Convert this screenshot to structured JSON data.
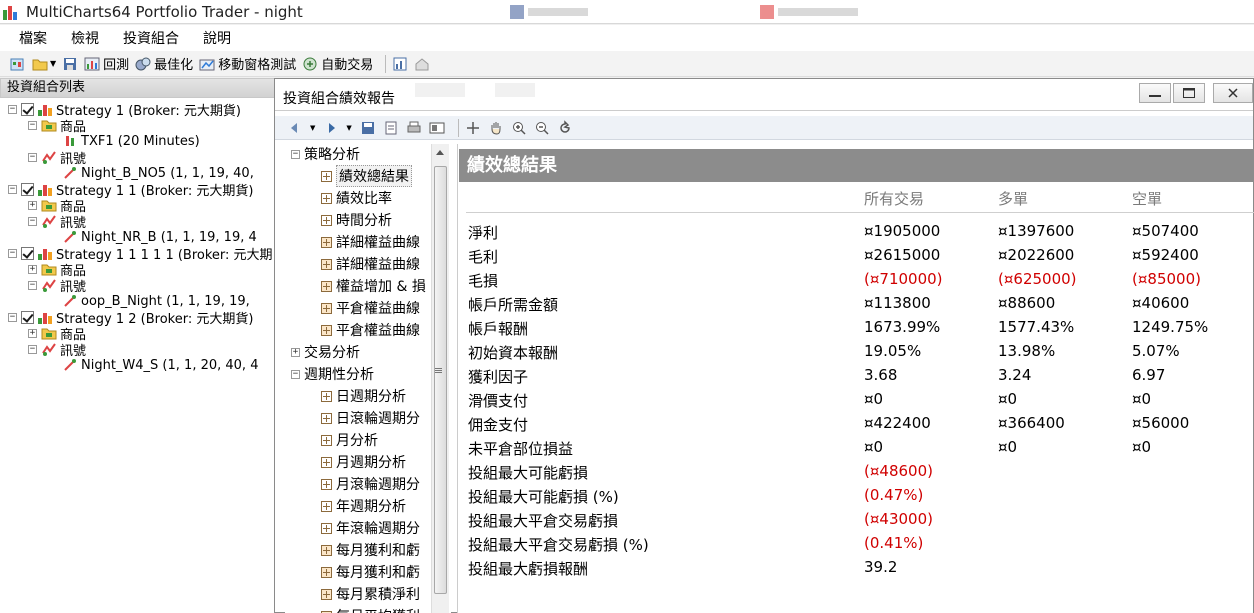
{
  "window": {
    "title": "MultiCharts64 Portfolio Trader - night"
  },
  "menu": [
    "檔案",
    "檢視",
    "投資組合",
    "說明"
  ],
  "toolbar": {
    "backtest": "回測",
    "optimize": "最佳化",
    "wfa": "移動窗格測試",
    "autotrade": "自動交易"
  },
  "left_panel": {
    "title": "投資組合列表",
    "rows": [
      {
        "level": 0,
        "expander": "-",
        "check": true,
        "text": "Strategy 1 (Broker: 元大期貨)"
      },
      {
        "level": 1,
        "expander": "-",
        "text": "商品",
        "icon": "folder-icon"
      },
      {
        "level": 2,
        "text": "TXF1 (20 Minutes)",
        "icon": "instrument-icon"
      },
      {
        "level": 1,
        "expander": "-",
        "text": "訊號",
        "icon": "signal-icon"
      },
      {
        "level": 2,
        "text": "Night_B_NO5 (1,  1,  19,  40,",
        "icon": "signal-item-icon"
      },
      {
        "level": 0,
        "expander": "-",
        "check": true,
        "text": "Strategy 1 1 (Broker: 元大期貨)"
      },
      {
        "level": 1,
        "expander": "+",
        "text": "商品",
        "icon": "folder-icon"
      },
      {
        "level": 1,
        "expander": "-",
        "text": "訊號",
        "icon": "signal-icon"
      },
      {
        "level": 2,
        "text": "Night_NR_B (1,  1,  19,  19,  4",
        "icon": "signal-item-icon"
      },
      {
        "level": 0,
        "expander": "-",
        "check": true,
        "text": "Strategy 1 1 1 1 1 (Broker: 元大期",
        "icon": "strategy-icon"
      },
      {
        "level": 1,
        "expander": "+",
        "text": "商品",
        "icon": "folder-icon"
      },
      {
        "level": 1,
        "expander": "-",
        "text": "訊號",
        "icon": "signal-icon"
      },
      {
        "level": 2,
        "text": "oop_B_Night (1,  1,  19,  19,",
        "icon": "signal-item-icon"
      },
      {
        "level": 0,
        "expander": "-",
        "check": true,
        "text": "Strategy 1 2 (Broker: 元大期貨)"
      },
      {
        "level": 1,
        "expander": "+",
        "text": "商品",
        "icon": "folder-icon"
      },
      {
        "level": 1,
        "expander": "-",
        "text": "訊號",
        "icon": "signal-icon"
      },
      {
        "level": 2,
        "text": "Night_W4_S (1,  1,  20,  40,  4",
        "icon": "signal-item-icon"
      }
    ]
  },
  "report": {
    "title": "投資組合績效報告",
    "nav": [
      {
        "level": 0,
        "expander": "-",
        "text": "策略分析"
      },
      {
        "level": 1,
        "text": "績效總結果",
        "selected": true
      },
      {
        "level": 1,
        "text": "績效比率"
      },
      {
        "level": 1,
        "text": "時間分析"
      },
      {
        "level": 1,
        "text": "詳細權益曲線",
        "chart": true
      },
      {
        "level": 1,
        "text": "詳細權益曲線",
        "chart": true
      },
      {
        "level": 1,
        "text": "權益增加 & 損",
        "chart": true
      },
      {
        "level": 1,
        "text": "平倉權益曲線",
        "chart": true
      },
      {
        "level": 1,
        "text": "平倉權益曲線",
        "chart": true
      },
      {
        "level": 0,
        "expander": "+",
        "text": "交易分析"
      },
      {
        "level": 0,
        "expander": "-",
        "text": "週期性分析"
      },
      {
        "level": 1,
        "text": "日週期分析"
      },
      {
        "level": 1,
        "text": "日滾輪週期分"
      },
      {
        "level": 1,
        "text": "月分析"
      },
      {
        "level": 1,
        "text": "月週期分析"
      },
      {
        "level": 1,
        "text": "月滾輪週期分"
      },
      {
        "level": 1,
        "text": "年週期分析"
      },
      {
        "level": 1,
        "text": "年滾輪週期分"
      },
      {
        "level": 1,
        "text": "每月獲利和虧",
        "chart": true
      },
      {
        "level": 1,
        "text": "每月獲利和虧",
        "chart": true
      },
      {
        "level": 1,
        "text": "每月累積淨利",
        "chart": true
      },
      {
        "level": 1,
        "text": "每月平均獲利",
        "chart": true
      }
    ],
    "header": "績效總結果",
    "columns": [
      "所有交易",
      "多單",
      "空單"
    ],
    "rows": [
      {
        "label": "淨利",
        "values": [
          "¤1905000",
          "¤1397600",
          "¤507400"
        ],
        "neg": [
          false,
          false,
          false
        ]
      },
      {
        "label": "毛利",
        "values": [
          "¤2615000",
          "¤2022600",
          "¤592400"
        ],
        "neg": [
          false,
          false,
          false
        ]
      },
      {
        "label": "毛損",
        "values": [
          "(¤710000)",
          "(¤625000)",
          "(¤85000)"
        ],
        "neg": [
          true,
          true,
          true
        ]
      },
      {
        "label": "帳戶所需金額",
        "values": [
          "¤113800",
          "¤88600",
          "¤40600"
        ],
        "neg": [
          false,
          false,
          false
        ]
      },
      {
        "label": "帳戶報酬",
        "values": [
          "1673.99%",
          "1577.43%",
          "1249.75%"
        ],
        "neg": [
          false,
          false,
          false
        ]
      },
      {
        "label": "初始資本報酬",
        "values": [
          "19.05%",
          "13.98%",
          "5.07%"
        ],
        "neg": [
          false,
          false,
          false
        ]
      },
      {
        "label": "獲利因子",
        "values": [
          "3.68",
          "3.24",
          "6.97"
        ],
        "neg": [
          false,
          false,
          false
        ]
      },
      {
        "label": "滑價支付",
        "values": [
          "¤0",
          "¤0",
          "¤0"
        ],
        "neg": [
          false,
          false,
          false
        ]
      },
      {
        "label": "佣金支付",
        "values": [
          "¤422400",
          "¤366400",
          "¤56000"
        ],
        "neg": [
          false,
          false,
          false
        ]
      },
      {
        "label": "未平倉部位損益",
        "values": [
          "¤0",
          "¤0",
          "¤0"
        ],
        "neg": [
          false,
          false,
          false
        ]
      },
      {
        "label": "投組最大可能虧損",
        "values": [
          "(¤48600)",
          "",
          ""
        ],
        "neg": [
          true,
          false,
          false
        ]
      },
      {
        "label": "投組最大可能虧損 (%)",
        "values": [
          "(0.47%)",
          "",
          ""
        ],
        "neg": [
          true,
          false,
          false
        ]
      },
      {
        "label": "投組最大平倉交易虧損",
        "values": [
          "(¤43000)",
          "",
          ""
        ],
        "neg": [
          true,
          false,
          false
        ]
      },
      {
        "label": "投組最大平倉交易虧損 (%)",
        "values": [
          "(0.41%)",
          "",
          ""
        ],
        "neg": [
          true,
          false,
          false
        ]
      },
      {
        "label": "投組最大虧損報酬",
        "values": [
          "39.2",
          "",
          ""
        ],
        "neg": [
          false,
          false,
          false
        ]
      }
    ]
  },
  "colors": {
    "negative": "#d00000",
    "header_bg": "#8c8c8c",
    "column_head": "#7a7a7a"
  }
}
